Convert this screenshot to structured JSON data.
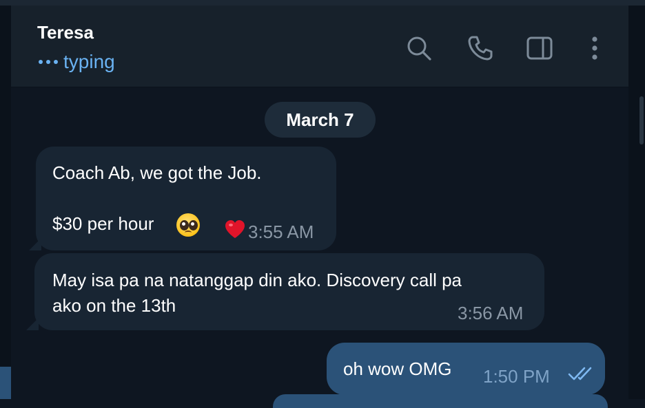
{
  "chat": {
    "contact_name": "Teresa",
    "status": "typing"
  },
  "header_actions": [
    {
      "name": "search",
      "icon": "search-icon"
    },
    {
      "name": "call",
      "icon": "phone-icon"
    },
    {
      "name": "sidebar",
      "icon": "sidebar-toggle-icon"
    },
    {
      "name": "more",
      "icon": "more-vertical-icon"
    }
  ],
  "messages": {
    "date_separator": "March 7",
    "items": [
      {
        "direction": "incoming",
        "lines": [
          "Coach Ab, we got the Job.",
          "",
          "$30 per hour"
        ],
        "emoji": "pleading-face",
        "reaction": "heart",
        "time": "3:55 AM"
      },
      {
        "direction": "incoming",
        "lines": [
          "May isa pa na natanggap din ako. Discovery call pa",
          "ako on the 13th"
        ],
        "time": "3:56 AM"
      },
      {
        "direction": "outgoing",
        "text": "oh wow OMG",
        "time": "1:50 PM",
        "status": "read"
      }
    ]
  },
  "colors": {
    "background": "#0e1621",
    "header": "#17212b",
    "incoming_bubble": "#182533",
    "outgoing_bubble": "#2b5278",
    "accent": "#6ab2f2",
    "timestamp": "#8a97a5"
  }
}
